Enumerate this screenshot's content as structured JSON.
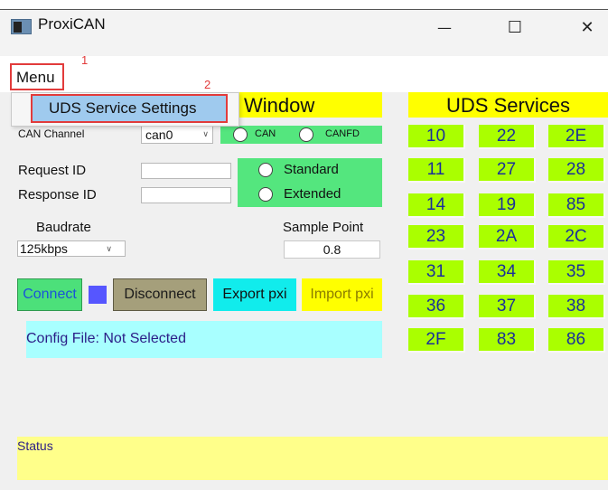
{
  "window": {
    "title": "ProxiCAN",
    "minimize_glyph": "—",
    "maximize_glyph": "☐",
    "close_glyph": "✕"
  },
  "menu": {
    "label": "Menu",
    "annotation": "1",
    "dropdown": {
      "item": "UDS Service Settings",
      "annotation": "2"
    }
  },
  "config": {
    "header_visible": "Window",
    "can_channel_label": "CAN Channel",
    "can_channel_value": "can0",
    "mode_options": [
      "CAN",
      "CANFD"
    ],
    "request_id_label": "Request ID",
    "response_id_label": "Response ID",
    "request_id_value": "",
    "response_id_value": "",
    "id_types": [
      "Standard",
      "Extended"
    ],
    "baudrate_label": "Baudrate",
    "baudrate_value": "125kbps",
    "sample_point_label": "Sample Point",
    "sample_point_value": "0.8"
  },
  "actions": {
    "connect": "Connect",
    "disconnect": "Disconnect",
    "export": "Export pxi",
    "import": "Import pxi"
  },
  "config_file_text": "Config File: Not Selected",
  "status_text": "Status",
  "uds": {
    "header": "UDS Services",
    "rows": [
      [
        "10",
        "22",
        "2E"
      ],
      [
        "11",
        "27",
        "28"
      ],
      [
        "14",
        "19",
        "85"
      ],
      [
        "23",
        "2A",
        "2C"
      ],
      [
        "31",
        "34",
        "35"
      ],
      [
        "36",
        "37",
        "38"
      ],
      [
        "2F",
        "83",
        "86"
      ]
    ]
  },
  "icons": {
    "app": "app-window-icon",
    "dropdown_chevron": "chevron-down-icon"
  },
  "colors": {
    "yellow": "#ffff00",
    "green": "#54e67e",
    "lime": "#aaff00",
    "cyan": "#11ecec",
    "light_cyan": "#a8ffff",
    "highlight_red": "#e23b3b"
  }
}
